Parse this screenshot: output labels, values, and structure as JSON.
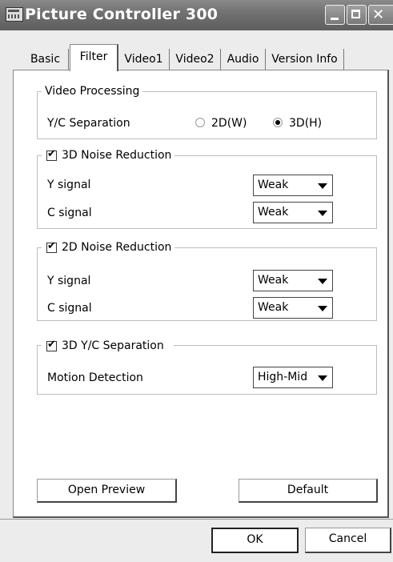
{
  "window": {
    "title": "Picture Controller 300"
  },
  "tabs": [
    {
      "label": "Basic",
      "active": false
    },
    {
      "label": "Filter",
      "active": true
    },
    {
      "label": "Video1",
      "active": false
    },
    {
      "label": "Video2",
      "active": false
    },
    {
      "label": "Audio",
      "active": false
    },
    {
      "label": "Version Info",
      "active": false
    }
  ],
  "video_processing": {
    "group_label": "Video Processing",
    "yc_label": "Y/C Separation",
    "option_2d": "2D(W)",
    "option_3d": "3D(H)",
    "selected": "3D(H)"
  },
  "noise3d": {
    "group_label": "3D Noise Reduction",
    "checked": true,
    "y_label": "Y signal",
    "y_value": "Weak",
    "c_label": "C signal",
    "c_value": "Weak"
  },
  "noise2d": {
    "group_label": "2D Noise Reduction",
    "checked": true,
    "y_label": "Y signal",
    "y_value": "Weak",
    "c_label": "C signal",
    "c_value": "Weak"
  },
  "yc3d": {
    "group_label": "3D Y/C Separation",
    "checked": true,
    "motion_label": "Motion Detection",
    "motion_value": "High-Mid"
  },
  "buttons": {
    "open_preview": "Open Preview",
    "default": "Default",
    "ok": "OK",
    "cancel": "Cancel"
  }
}
